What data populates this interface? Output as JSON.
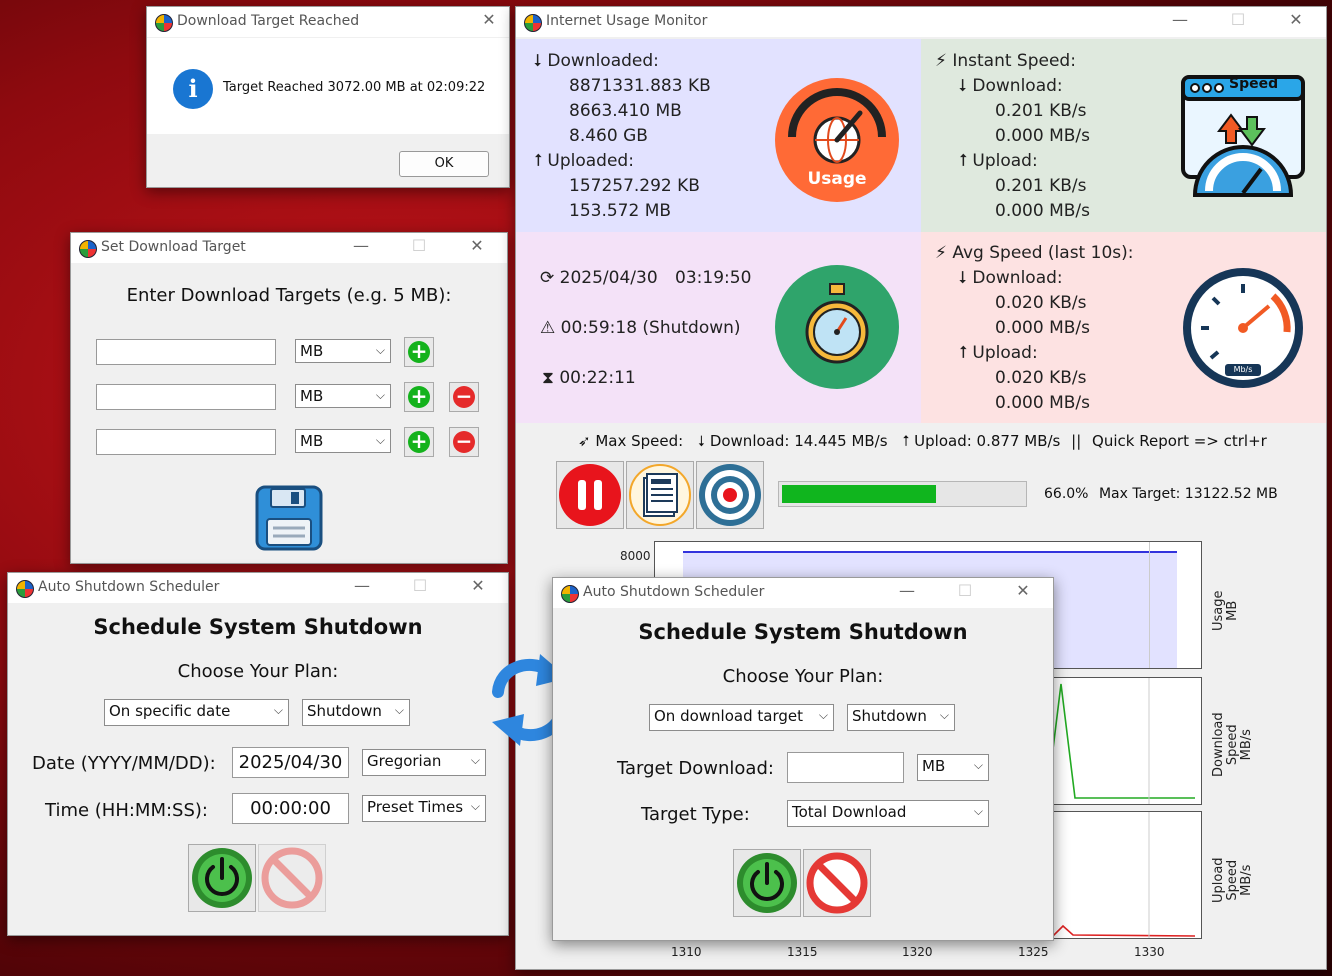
{
  "target_dialog": {
    "title": "Download Target Reached",
    "message": "Target Reached 3072.00 MB at 02:09:22",
    "ok_label": "OK"
  },
  "set_target": {
    "title": "Set Download Target",
    "heading": "Enter Download Targets (e.g. 5 MB):",
    "rows": [
      {
        "value": "",
        "unit": "MB"
      },
      {
        "value": "",
        "unit": "MB"
      },
      {
        "value": "",
        "unit": "MB"
      }
    ]
  },
  "monitor": {
    "title": "Internet Usage Monitor",
    "downloaded_label": "Downloaded:",
    "downloaded": [
      "8871331.883 KB",
      "8663.410 MB",
      "8.460 GB"
    ],
    "uploaded_label": "Uploaded:",
    "uploaded": [
      "157257.292 KB",
      "153.572 MB"
    ],
    "usage_icon_label": "Usage",
    "instant_label": "Instant Speed:",
    "download_label": "Download:",
    "upload_label": "Upload:",
    "instant_download": [
      "0.201 KB/s",
      "0.000 MB/s"
    ],
    "instant_upload": [
      "0.201 KB/s",
      "0.000 MB/s"
    ],
    "speed_icon_label": "Speed",
    "date": "2025/04/30",
    "time": "03:19:50",
    "shutdown_remaining": "00:59:18  (Shutdown)",
    "elapsed": "00:22:11",
    "avg_label": "Avg Speed (last 10s):",
    "avg_download": [
      "0.020 KB/s",
      "0.000 MB/s"
    ],
    "avg_upload": [
      "0.020 KB/s",
      "0.000 MB/s"
    ],
    "gauge_unit": "Mb/s",
    "max_speed_label": "Max Speed:",
    "max_download": "Download: 14.445 MB/s",
    "max_upload": "Upload: 0.877 MB/s",
    "separator": "||",
    "quick_report": "Quick Report => ctrl+r",
    "progress_fraction": 0.66,
    "progress_text": "66.0%",
    "max_target": "Max Target: 13122.52 MB",
    "ytick_8000": "8000",
    "x_ticks": [
      "1310",
      "1315",
      "1320",
      "1325",
      "1330"
    ],
    "usage_axis": "Usage\nMB",
    "download_axis": "Download\nSpeed\nMB/s",
    "upload_axis": "Upload\nSpeed\nMB/s"
  },
  "scheduler_left": {
    "title": "Auto Shutdown Scheduler",
    "heading": "Schedule System Shutdown",
    "plan_label": "Choose Your Plan:",
    "plan": "On specific date",
    "action": "Shutdown",
    "date_label": "Date (YYYY/MM/DD):",
    "date_value": "2025/04/30",
    "calendar": "Gregorian",
    "time_label": "Time (HH:MM:SS):",
    "time_value": "00:00:00",
    "preset": "Preset Times"
  },
  "scheduler_right": {
    "title": "Auto Shutdown Scheduler",
    "heading": "Schedule System Shutdown",
    "plan_label": "Choose Your Plan:",
    "plan": "On download target",
    "action": "Shutdown",
    "target_label": "Target Download:",
    "target_value": "",
    "unit": "MB",
    "type_label": "Target Type:",
    "type_value": "Total Download"
  },
  "colors": {
    "pane_blue": "#e2e2ff",
    "pane_green": "#dfe9de",
    "pane_pink": "#f4e2f8",
    "pane_red": "#fde2e2",
    "progress": "#10b51e",
    "usage_line": "#3333dd",
    "download_line": "#22aa22",
    "upload_line": "#dd2222"
  }
}
